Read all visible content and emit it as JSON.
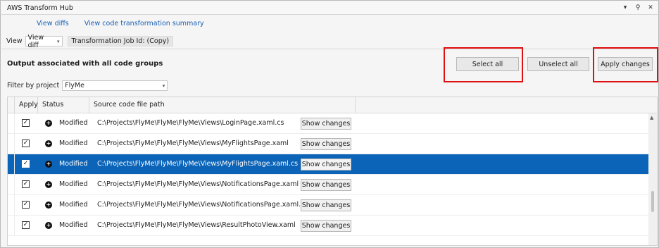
{
  "window": {
    "title": "AWS Transform Hub",
    "icons": [
      "chevron-down-icon",
      "pin-icon",
      "close-icon"
    ]
  },
  "links": {
    "view_diffs": "View diffs",
    "view_summary": "View code transformation summary"
  },
  "view_row": {
    "label": "View",
    "selected": "View diff",
    "job_id": "Transformation Job Id:  (Copy)"
  },
  "section": {
    "title": "Output associated with all code groups"
  },
  "buttons": {
    "select_all": "Select all",
    "unselect_all": "Unselect all",
    "apply_changes": "Apply changes"
  },
  "filter": {
    "label": "Filter by project",
    "selected": "FlyMe"
  },
  "grid": {
    "columns": {
      "apply": "Apply",
      "status": "Status",
      "path": "Source code file path"
    },
    "show_label": "Show changes",
    "rows": [
      {
        "checked": "✓",
        "status": "Modified",
        "path": "C:\\Projects\\FlyMe\\FlyMe\\FlyMe\\Views\\LoginPage.xaml.cs",
        "selected": false
      },
      {
        "checked": "✓",
        "status": "Modified",
        "path": "C:\\Projects\\FlyMe\\FlyMe\\FlyMe\\Views\\MyFlightsPage.xaml",
        "selected": false
      },
      {
        "checked": "✓",
        "status": "Modified",
        "path": "C:\\Projects\\FlyMe\\FlyMe\\FlyMe\\Views\\MyFlightsPage.xaml.cs",
        "selected": true
      },
      {
        "checked": "✓",
        "status": "Modified",
        "path": "C:\\Projects\\FlyMe\\FlyMe\\FlyMe\\Views\\NotificationsPage.xaml",
        "selected": false
      },
      {
        "checked": "✓",
        "status": "Modified",
        "path": "C:\\Projects\\FlyMe\\FlyMe\\FlyMe\\Views\\NotificationsPage.xaml.cs",
        "selected": false
      },
      {
        "checked": "✓",
        "status": "Modified",
        "path": "C:\\Projects\\FlyMe\\FlyMe\\FlyMe\\Views\\ResultPhotoView.xaml",
        "selected": false
      }
    ]
  },
  "colors": {
    "selection": "#0b64b8",
    "link": "#1a5fb4",
    "highlight_box": "#e01010"
  }
}
